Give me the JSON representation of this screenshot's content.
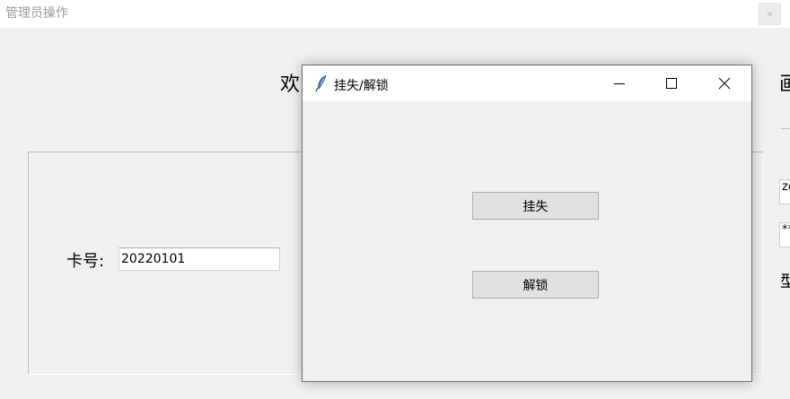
{
  "background_window": {
    "title": "管理员操作",
    "close_glyph": "×",
    "welcome_text": "欢",
    "right_heading_fragment": "画",
    "card_label": "卡号:",
    "card_value": "20220101",
    "right_field_1": "zc",
    "right_field_2": "**",
    "right_label_fragment": "型"
  },
  "dialog": {
    "title": "挂失/解锁",
    "buttons": {
      "report_lost": "挂失",
      "unlock": "解锁"
    }
  }
}
